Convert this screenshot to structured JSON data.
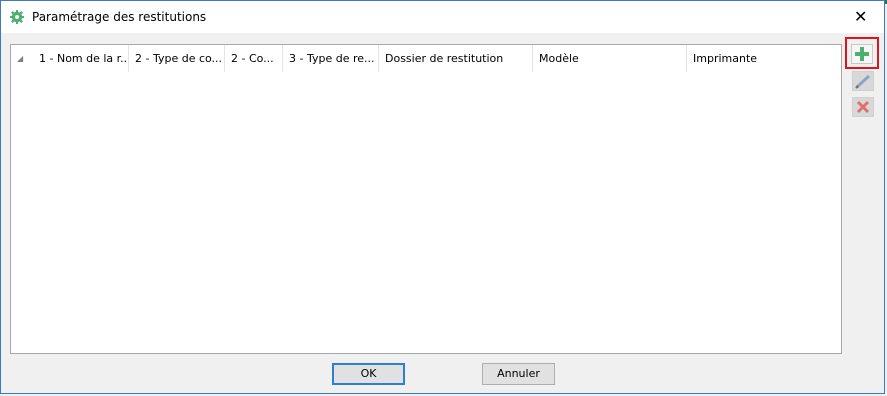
{
  "window": {
    "title": "Paramétrage des restitutions",
    "close_glyph": "✕"
  },
  "grid": {
    "columns": [
      "1 - Nom de la r...",
      "2 - Type de co...",
      "2 - Co...",
      "3 - Type de re...",
      "Dossier de restitution",
      "Modèle",
      "Imprimante"
    ],
    "rows": []
  },
  "side_actions": {
    "add_icon": "plus-icon",
    "edit_icon": "pencil-icon",
    "delete_icon": "delete-x-icon"
  },
  "footer": {
    "ok_label": "OK",
    "cancel_label": "Annuler"
  },
  "colors": {
    "accent_border": "#3c7bc4",
    "add_green": "#4caf6e",
    "delete_red": "#e07070",
    "highlight": "#e0141e"
  }
}
